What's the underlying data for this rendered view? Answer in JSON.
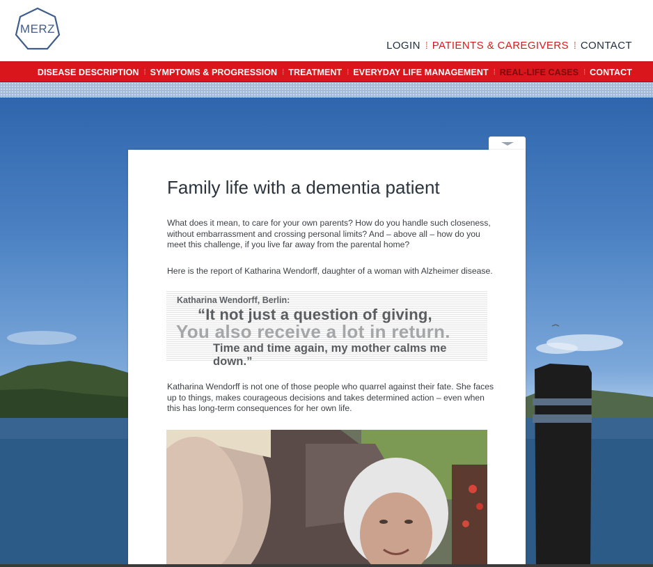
{
  "logo": {
    "text": "MERZ"
  },
  "topnav": {
    "items": [
      {
        "label": "LOGIN",
        "active": false
      },
      {
        "label": "PATIENTS & CAREGIVERS",
        "active": true
      },
      {
        "label": "CONTACT",
        "active": false
      }
    ]
  },
  "mainnav": {
    "items": [
      {
        "label": "DISEASE DESCRIPTION",
        "active": false
      },
      {
        "label": "SYMPTOMS & PROGRESSION",
        "active": false
      },
      {
        "label": "TREATMENT",
        "active": false
      },
      {
        "label": "EVERYDAY LIFE MANAGEMENT",
        "active": false
      },
      {
        "label": "REAL-LIFE CASES",
        "active": true
      },
      {
        "label": "CONTACT",
        "active": false
      }
    ]
  },
  "article": {
    "title": "Family life with a dementia patient",
    "intro": "What does it mean, to care for your own parents? How do you handle such closeness, without embarrassment and crossing personal limits? And – above all – how do you meet this challenge, if you live far away from the parental home?",
    "report": "Here is the report of Katharina Wendorff, daughter of a woman with Alzheimer disease.",
    "quote": {
      "author": "Katharina Wendorff, Berlin:",
      "line1": "“It not just a question of giving,",
      "line2": "You also receive a lot in return.",
      "line3": "Time and time again, my mother calms me down.”"
    },
    "body": "Katharina Wendorff is not one of those people who quarrel against their fate. She faces up to things, makes courageous decisions and takes determined action – even when this has long-term consequences for her own life."
  },
  "colors": {
    "brand_red": "#d8161c",
    "logo_blue": "#3f5d8a",
    "text_dark": "#2b333d"
  }
}
